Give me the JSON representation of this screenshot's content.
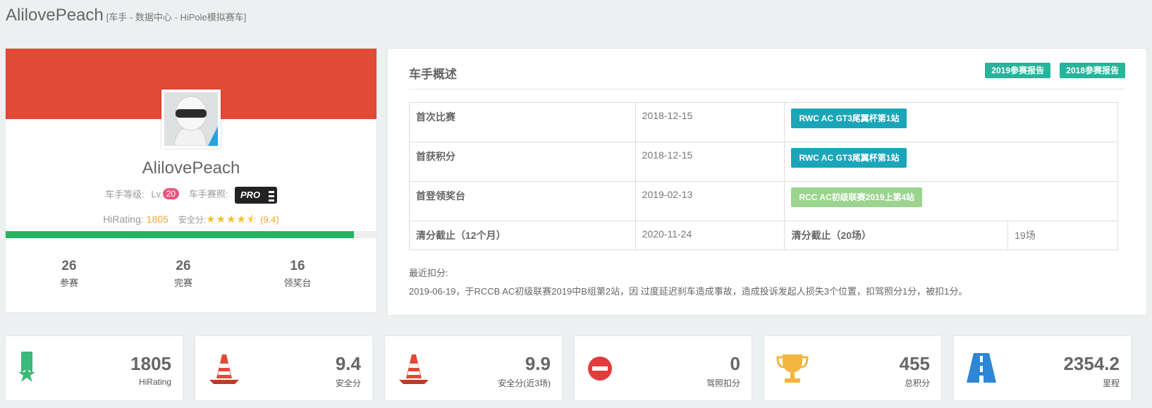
{
  "header": {
    "title": "AlilovePeach",
    "subtitle": "[车手 - 数据中心 - HiPole模拟赛车]"
  },
  "profile": {
    "name": "AlilovePeach",
    "level_label": "车手等级:",
    "level_prefix": "Lv.",
    "level": "20",
    "license_label": "车手赛照:",
    "license_badge": "PRO",
    "rating_label": "HiRating:",
    "rating": "1805",
    "safety_label": "安全分:",
    "stars": "★★★★⯪",
    "safety_score": "(9.4)",
    "progress_fraction": 0.94,
    "stats": [
      {
        "value": "26",
        "label": "参赛"
      },
      {
        "value": "26",
        "label": "完赛"
      },
      {
        "value": "16",
        "label": "领奖台"
      }
    ],
    "colors": {
      "banner": "#e04a37",
      "progress": "#27b264"
    }
  },
  "overview": {
    "title": "车手概述",
    "buttons": [
      "2019参赛报告",
      "2018参赛报告"
    ],
    "rows": [
      {
        "label": "首次比赛",
        "date": "2018-12-15",
        "race": "RWC AC GT3尾翼杯第1站"
      },
      {
        "label": "首获积分",
        "date": "2018-12-15",
        "race": "RWC AC GT3尾翼杯第1站"
      },
      {
        "label": "首登领奖台",
        "date": "2019-02-13",
        "race": "RCC AC初级联赛2019上第4站"
      }
    ],
    "last_row": {
      "label": "清分截止（12个月）",
      "date": "2020-11-24",
      "label2": "清分截止（20场）",
      "value2": "19场"
    },
    "recent_label": "最近扣分:",
    "recent_text": "2019-06-19，于RCCB AC初级联赛2019中B组第2站，因 过度延迟刹车造成事故，造成投诉发起人损失3个位置，扣驾照分1分，被扣1分。"
  },
  "stat_boxes": [
    {
      "value": "1805",
      "label": "HiRating",
      "icon": "ribbon-star-icon"
    },
    {
      "value": "9.4",
      "label": "安全分",
      "icon": "traffic-cone-icon"
    },
    {
      "value": "9.9",
      "label": "安全分(近3场)",
      "icon": "traffic-cone-icon"
    },
    {
      "value": "0",
      "label": "驾照扣分",
      "icon": "no-entry-icon"
    },
    {
      "value": "455",
      "label": "总积分",
      "icon": "trophy-icon"
    },
    {
      "value": "2354.2",
      "label": "里程",
      "icon": "road-icon"
    }
  ]
}
